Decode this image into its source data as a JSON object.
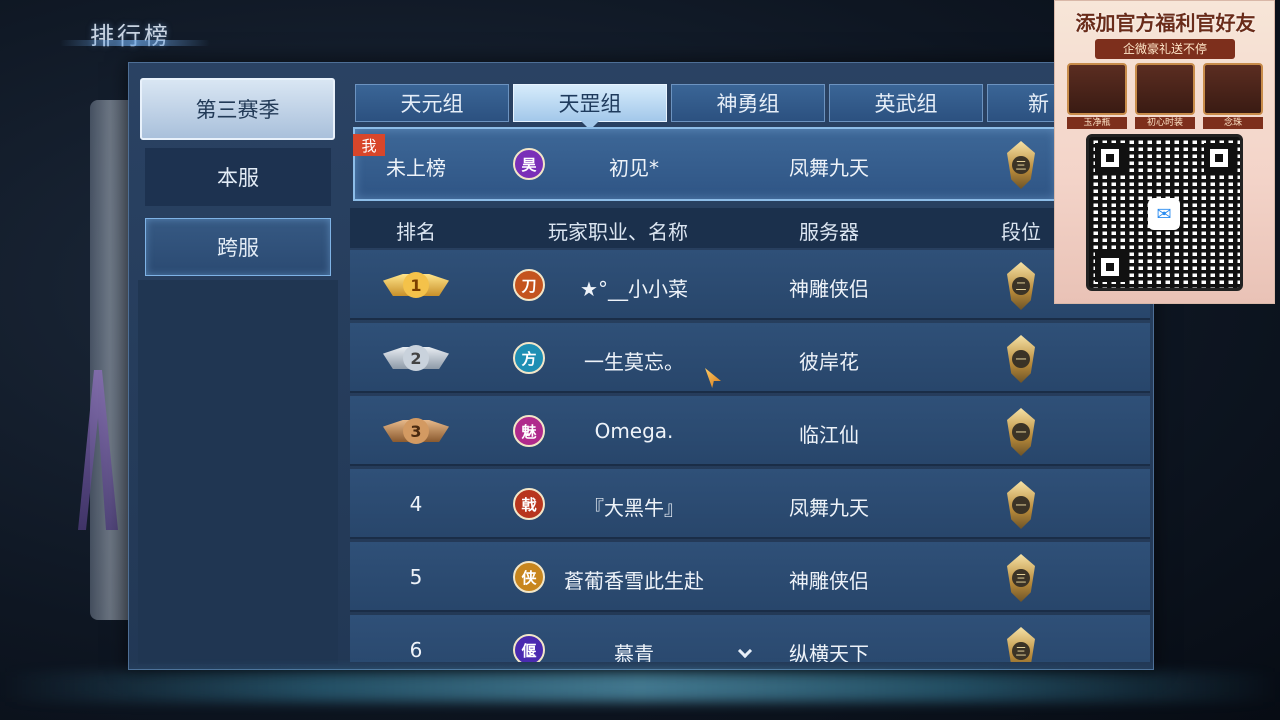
{
  "page": {
    "title": "排行榜"
  },
  "sidebar": {
    "season_label": "第三赛季",
    "local_server_label": "本服",
    "cross_server_label": "跨服"
  },
  "tabs": [
    {
      "label": "天元组",
      "active": false
    },
    {
      "label": "天罡组",
      "active": true
    },
    {
      "label": "神勇组",
      "active": false
    },
    {
      "label": "英武组",
      "active": false
    },
    {
      "label": "新",
      "active": false
    }
  ],
  "my_rank": {
    "badge": "我",
    "rank": "未上榜",
    "class_glyph": "昊",
    "class_color": "#7a2fb8",
    "name": "初见*",
    "server": "凤舞九天",
    "tier_glyph": "三"
  },
  "columns": {
    "rank": "排名",
    "player": "玩家职业、名称",
    "server": "服务器",
    "tier": "段位"
  },
  "rows": [
    {
      "rank": "1",
      "medal": "gold",
      "class_glyph": "刀",
      "class_color": "#c4531e",
      "name": "★°__小小菜",
      "server": "神雕侠侣",
      "tier_glyph": "二"
    },
    {
      "rank": "2",
      "medal": "silver",
      "class_glyph": "方",
      "class_color": "#1e8fb4",
      "name": "一生莫忘。",
      "server": "彼岸花",
      "tier_glyph": "一"
    },
    {
      "rank": "3",
      "medal": "bronze",
      "class_glyph": "魅",
      "class_color": "#b02a8c",
      "name": "Omega.",
      "server": "临江仙",
      "tier_glyph": "一"
    },
    {
      "rank": "4",
      "medal": "",
      "class_glyph": "戟",
      "class_color": "#b8361e",
      "name": "『大黑牛』",
      "server": "凤舞九天",
      "tier_glyph": "一"
    },
    {
      "rank": "5",
      "medal": "",
      "class_glyph": "侠",
      "class_color": "#c8861e",
      "name": "蒼葡香雪此生赴",
      "server": "神雕侠侣",
      "tier_glyph": "三"
    },
    {
      "rank": "6",
      "medal": "",
      "class_glyph": "偃",
      "class_color": "#4a2ab0",
      "name": "慕青",
      "server": "纵横天下",
      "tier_glyph": "三"
    }
  ],
  "promo": {
    "title": "添加官方福利官好友",
    "subtitle": "企微豪礼送不停",
    "gifts": [
      "玉净瓶",
      "初心时装",
      "念珠"
    ]
  }
}
